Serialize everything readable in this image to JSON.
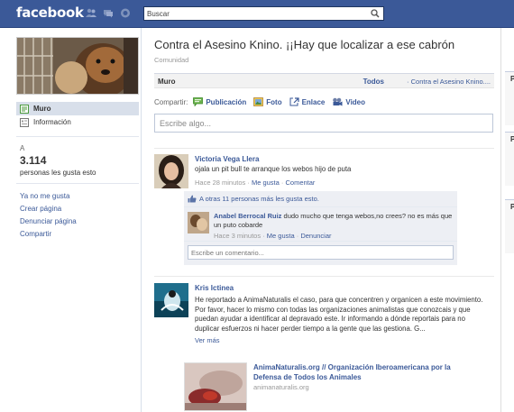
{
  "header": {
    "logo": "facebook",
    "search_placeholder": "Buscar"
  },
  "sidebar": {
    "nav": [
      {
        "label": "Muro",
        "selected": true
      },
      {
        "label": "Información",
        "selected": false
      }
    ],
    "likes_prefix": "A",
    "likes_count": "3.114",
    "likes_desc": "personas les gusta esto",
    "links": [
      "Ya no me gusta",
      "Crear página",
      "Denunciar página",
      "Compartir"
    ]
  },
  "page": {
    "title": "Contra el Asesino Knino. ¡¡Hay que localizar a ese cabrón",
    "category": "Comunidad"
  },
  "wall": {
    "label": "Muro",
    "filter_all": "Todos",
    "filter_page": "· Contra el Asesino Knino...."
  },
  "share": {
    "label": "Compartir:",
    "options": [
      "Publicación",
      "Foto",
      "Enlace",
      "Video"
    ],
    "placeholder": "Escribe algo..."
  },
  "posts": [
    {
      "author": "Victoria Vega Llera",
      "text": "ojala un pit bull te arranque los webos hijo de puta",
      "time": "Hace 28 minutos",
      "actions": [
        "Me gusta",
        "Comentar"
      ],
      "likes_text": "A otras 11 personas más les gusta esto.",
      "comment": {
        "author": "Anabel Berrocal Ruiz",
        "text": " dudo mucho que tenga webos,no crees? no es más que un puto cobarde",
        "time": "Hace 3 minutos",
        "actions": [
          "Me gusta",
          "Denunciar"
        ]
      },
      "comment_placeholder": "Escribe un comentario..."
    },
    {
      "author": "Kris Ictinea",
      "text": "He reportado a AnimaNaturalis el caso, para que concentren y organicen a este movimiento. Por favor, hacer lo mismo con todas las organizaciones animalistas que conozcais y que puedan ayudar a identificar al depravado este. Ir informando a dónde reportais para no duplicar esfuerzos ni hacer perder tiempo a la gente que las gestiona. G...",
      "see_more": "Ver más",
      "attachment": {
        "title": "AnimaNaturalis.org // Organización Iberoamericana por la Defensa de Todos los Animales",
        "domain": "animanaturalis.org"
      }
    }
  ],
  "right_column": {
    "box_initials": [
      "P",
      "P",
      "P"
    ]
  },
  "colors": {
    "brand": "#3b5998",
    "nav_selected": "#d8dfea",
    "ufi_bg": "#edeff4"
  }
}
